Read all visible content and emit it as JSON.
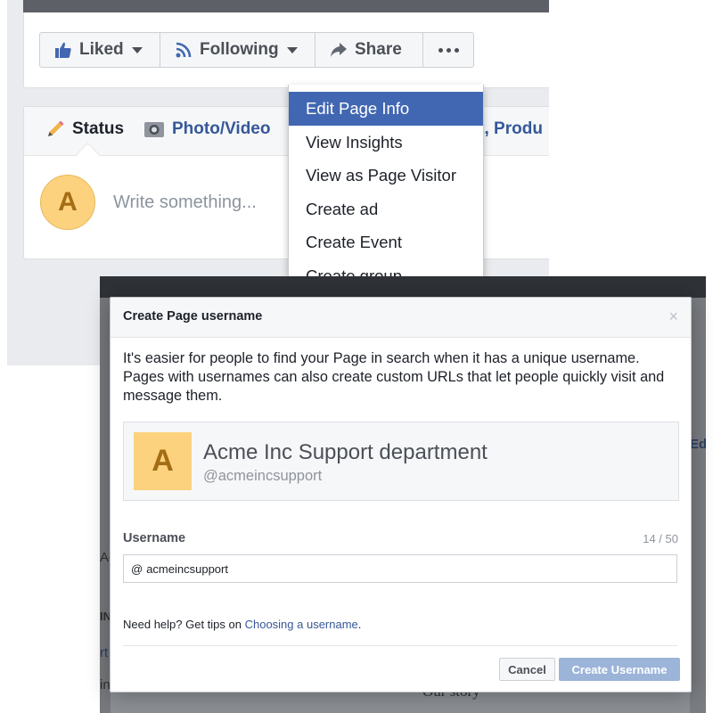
{
  "action_bar": {
    "liked_label": "Liked",
    "following_label": "Following",
    "share_label": "Share"
  },
  "composer": {
    "tabs": {
      "status": "Status",
      "photo": "Photo/Video",
      "offer": "ent, Produ"
    },
    "avatar_letter": "A",
    "placeholder": "Write something..."
  },
  "dropdown": {
    "items": [
      "Edit Page Info",
      "View Insights",
      "View as Page Visitor",
      "Create ad",
      "Create Event",
      "Create group"
    ]
  },
  "behind_modal": {
    "left_peek": [
      "Ac",
      "IN",
      "rt",
      "in"
    ],
    "right_peek": "Edi",
    "bottom_peek": "Our story"
  },
  "modal": {
    "title": "Create Page username",
    "close": "×",
    "description": "It's easier for people to find your Page in search when it has a unique username. Pages with usernames can also create custom URLs that let people quickly visit and message them.",
    "page": {
      "avatar_letter": "A",
      "name": "Acme Inc Support department",
      "handle": "@acmeincsupport"
    },
    "username": {
      "label": "Username",
      "count": "14 / 50",
      "prefix": "@",
      "value": "acmeincsupport"
    },
    "help": {
      "text": "Need help? Get tips on ",
      "link": "Choosing a username",
      "suffix": "."
    },
    "buttons": {
      "cancel": "Cancel",
      "create": "Create Username"
    }
  },
  "colors": {
    "brand_blue": "#4267b2",
    "link_blue": "#365899",
    "avatar_yellow": "#fcd27e",
    "disabled_blue": "#9cb4d8"
  }
}
